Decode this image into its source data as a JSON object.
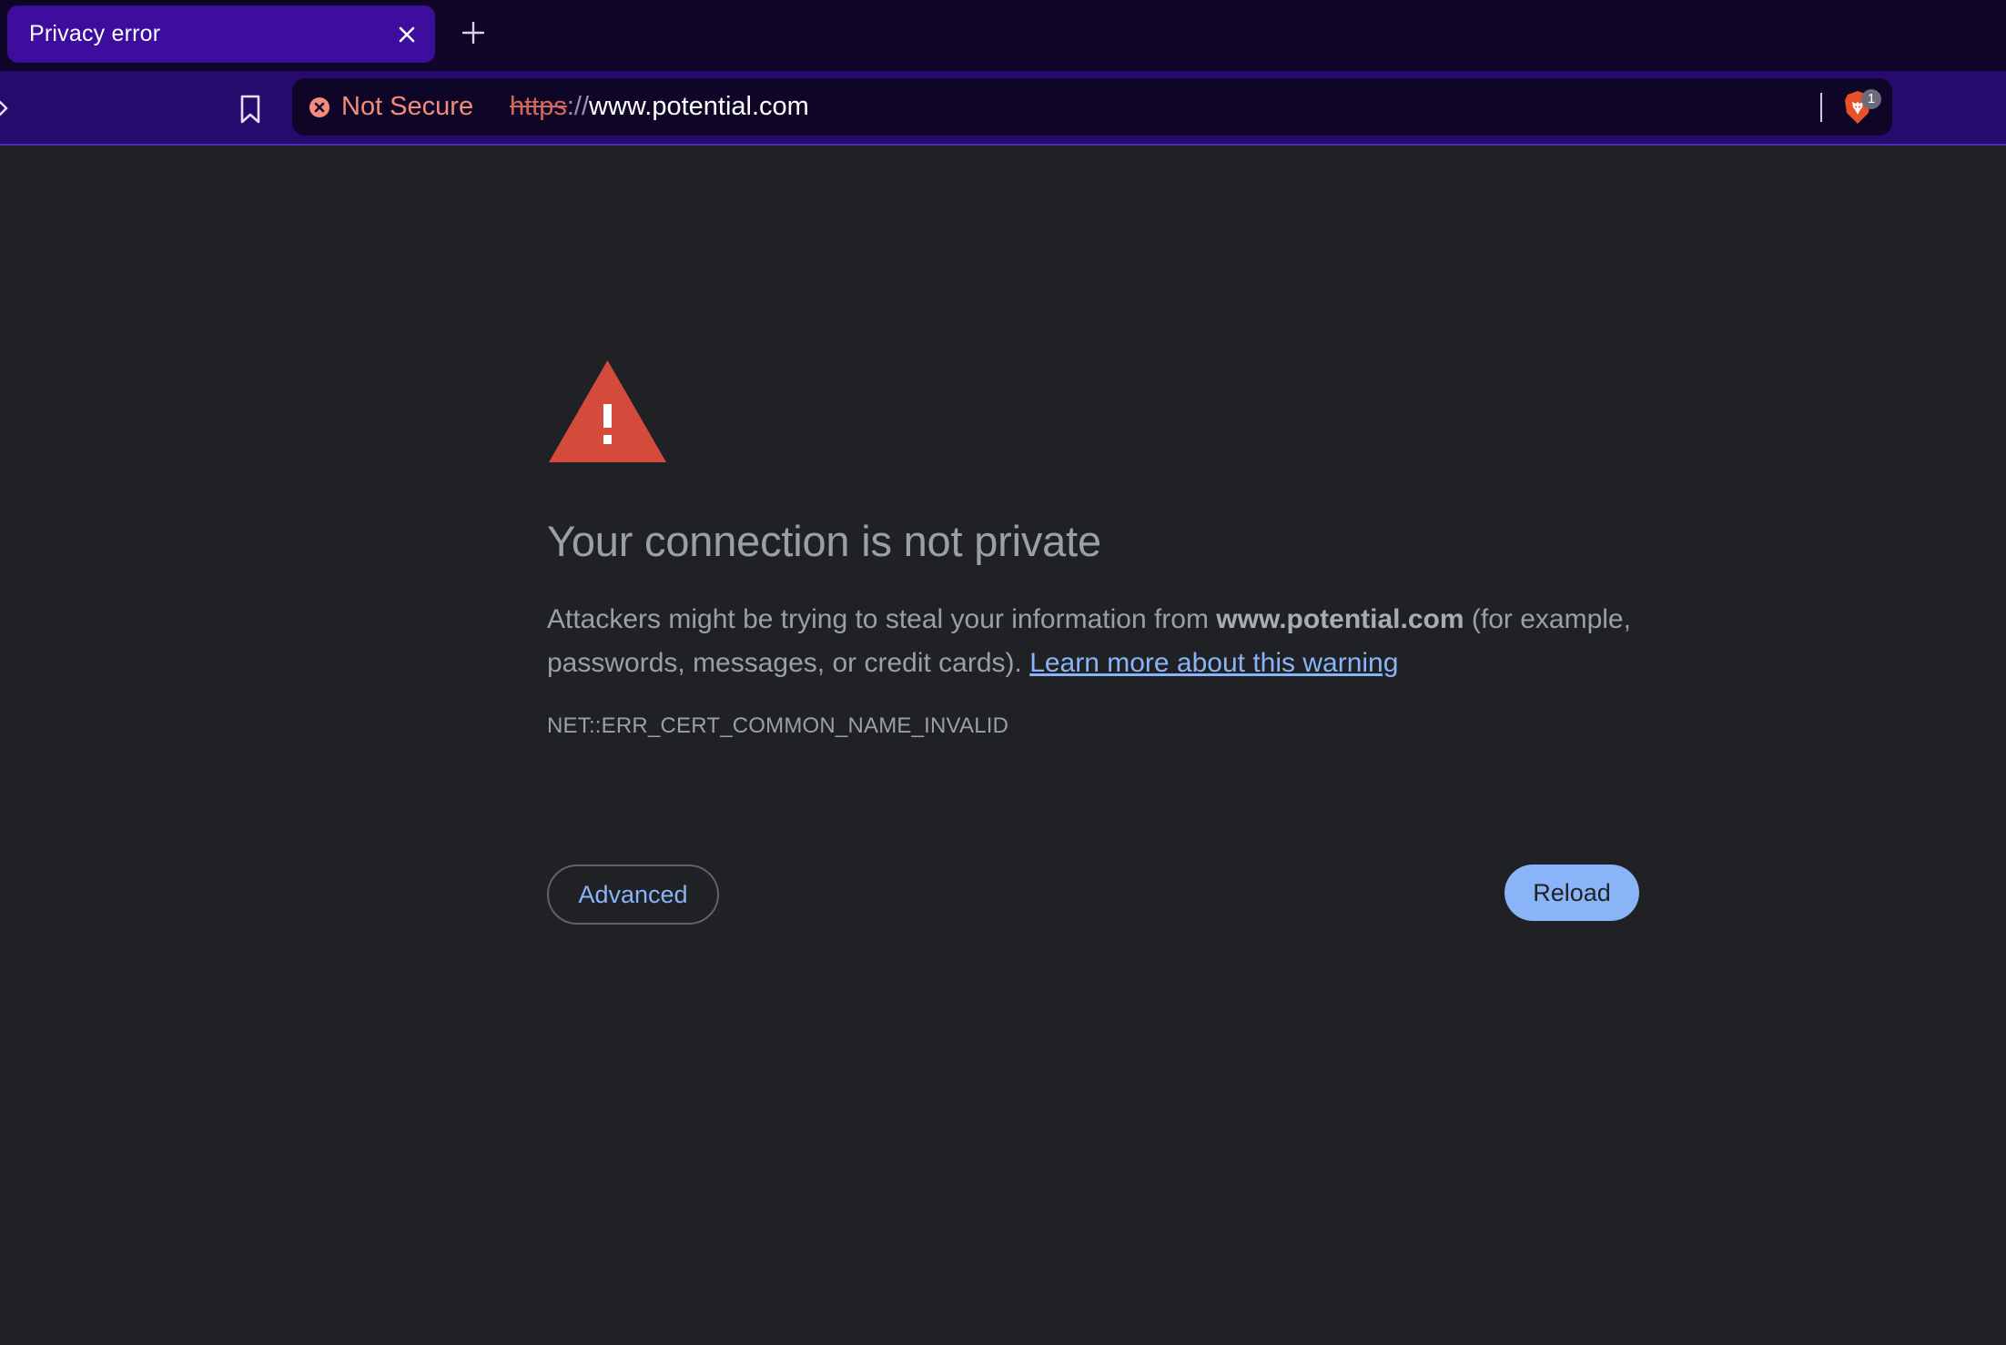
{
  "browser": {
    "tab": {
      "title": "Privacy error",
      "close_icon": "close-icon"
    },
    "new_tab_icon": "plus-icon",
    "toolbar": {
      "bookmark_icon": "bookmark-icon"
    },
    "omnibox": {
      "security_icon": "error-circle-icon",
      "security_label": "Not Secure",
      "url_scheme": "https",
      "url_separator": "://",
      "url_host": "www.potential.com",
      "shields_icon": "brave-shields-icon",
      "shields_badge": "1"
    }
  },
  "page": {
    "warning_icon": "warning-triangle-icon",
    "heading": "Your connection is not private",
    "explanation": {
      "prefix": "Attackers might be trying to steal your information from ",
      "domain": "www.potential.com",
      "suffix": " (for example, passwords, messages, or credit cards). ",
      "learn_more": "Learn more about this warning"
    },
    "error_code": "NET::ERR_CERT_COMMON_NAME_INVALID",
    "buttons": {
      "advanced": "Advanced",
      "reload": "Reload"
    }
  },
  "colors": {
    "tabstrip_bg": "#0f0627",
    "tab_active_bg": "#3d0d9e",
    "toolbar_bg": "#270a6e",
    "page_bg": "#202124",
    "not_secure_red": "#f28b7c",
    "warning_red": "#d44b3c",
    "link_blue": "#8ab4f8"
  }
}
